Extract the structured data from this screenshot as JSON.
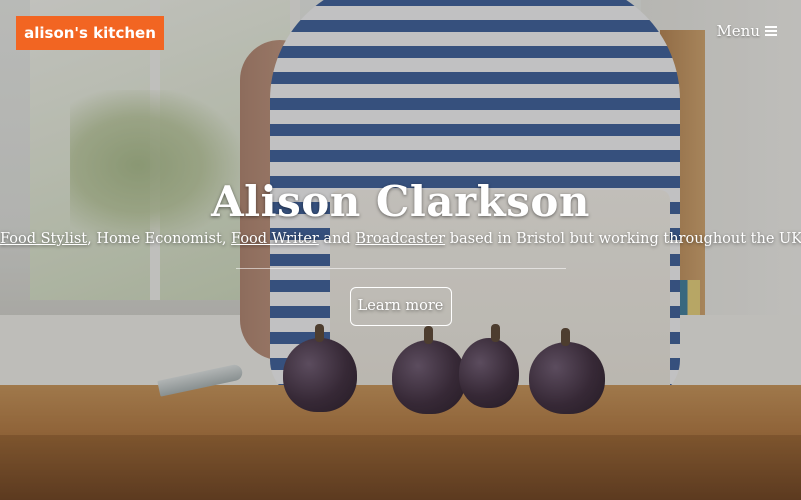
{
  "brand": {
    "logo_text": "alison's kitchen",
    "accent_color": "#f26522"
  },
  "nav": {
    "menu_label": "Menu",
    "menu_icon": "hamburger-icon"
  },
  "hero": {
    "title": "Alison Clarkson",
    "tagline": {
      "link_1": "Food Stylist",
      "sep_1": ", ",
      "text_1": "Home Economist",
      "sep_2": ", ",
      "link_2": "Food Writer",
      "text_2": " and ",
      "link_3": "Broadcaster",
      "text_3": " based in Bristol but working throughout the UK."
    },
    "cta_label": "Learn more"
  }
}
